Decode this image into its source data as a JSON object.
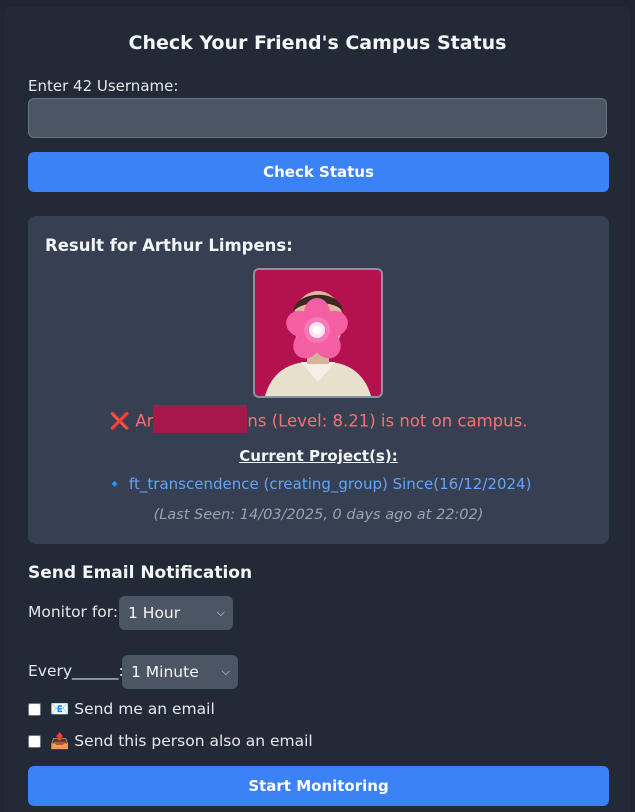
{
  "header": {
    "title": "Check Your Friend's Campus Status"
  },
  "search": {
    "label": "Enter 42 Username:",
    "value": "",
    "button": "Check Status"
  },
  "result": {
    "title": "Result for Arthur Limpens:",
    "status_icon": "❌",
    "status_prefix": "Ar",
    "status_suffix": "ns (Level: 8.21) is not on campus.",
    "projects_heading": "Current Project(s):",
    "project_bullet": "🔹",
    "project": "ft_transcendence (creating_group) Since(16/12/2024)",
    "last_seen": "(Last Seen: 14/03/2025, 0 days ago at 22:02)"
  },
  "email": {
    "section_title": "Send Email Notification",
    "monitor_label": "Monitor for:",
    "monitor_value": "1 Hour",
    "every_label": "Every______:",
    "every_value": "1 Minute",
    "check_self": "📧 Send me an email",
    "check_other": "📤 Send this person also an email",
    "button": "Start Monitoring"
  },
  "icons": {
    "select_arrow": "chevron-down-icon"
  },
  "colors": {
    "accent": "#3b82f6",
    "error": "#f87171",
    "link": "#60a5fa"
  }
}
